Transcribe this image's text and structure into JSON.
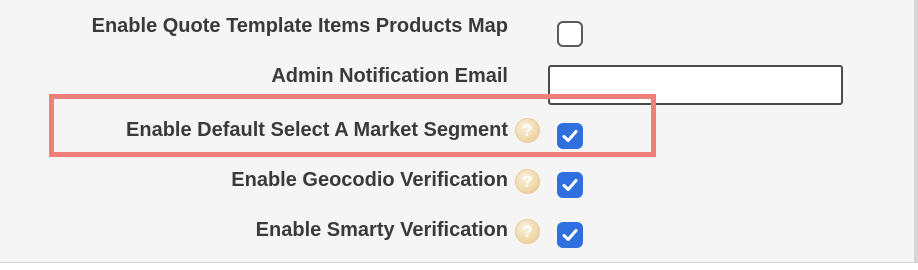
{
  "settings": {
    "rows": [
      {
        "label": "Enable Quote Template Items Products Map",
        "control": "checkbox",
        "checked": false,
        "has_help": false
      },
      {
        "label": "Admin Notification Email",
        "control": "text-input",
        "value": "",
        "placeholder": ""
      },
      {
        "label": "Enable Default Select A Market Segment",
        "control": "checkbox",
        "checked": true,
        "has_help": true
      },
      {
        "label": "Enable Geocodio Verification",
        "control": "checkbox",
        "checked": true,
        "has_help": true
      },
      {
        "label": "Enable Smarty Verification",
        "control": "checkbox",
        "checked": true,
        "has_help": true
      }
    ]
  },
  "help_icon_glyph": "?",
  "icons": {
    "help": "help-icon",
    "checkmark": "checkmark-icon"
  },
  "colors": {
    "checkbox_checked": "#2f6fe0",
    "highlight": "#ef7f78",
    "label_text": "#3a3a3a",
    "background": "#f5f5f5"
  },
  "highlighted_row": "Enable Default Select A Market Segment"
}
